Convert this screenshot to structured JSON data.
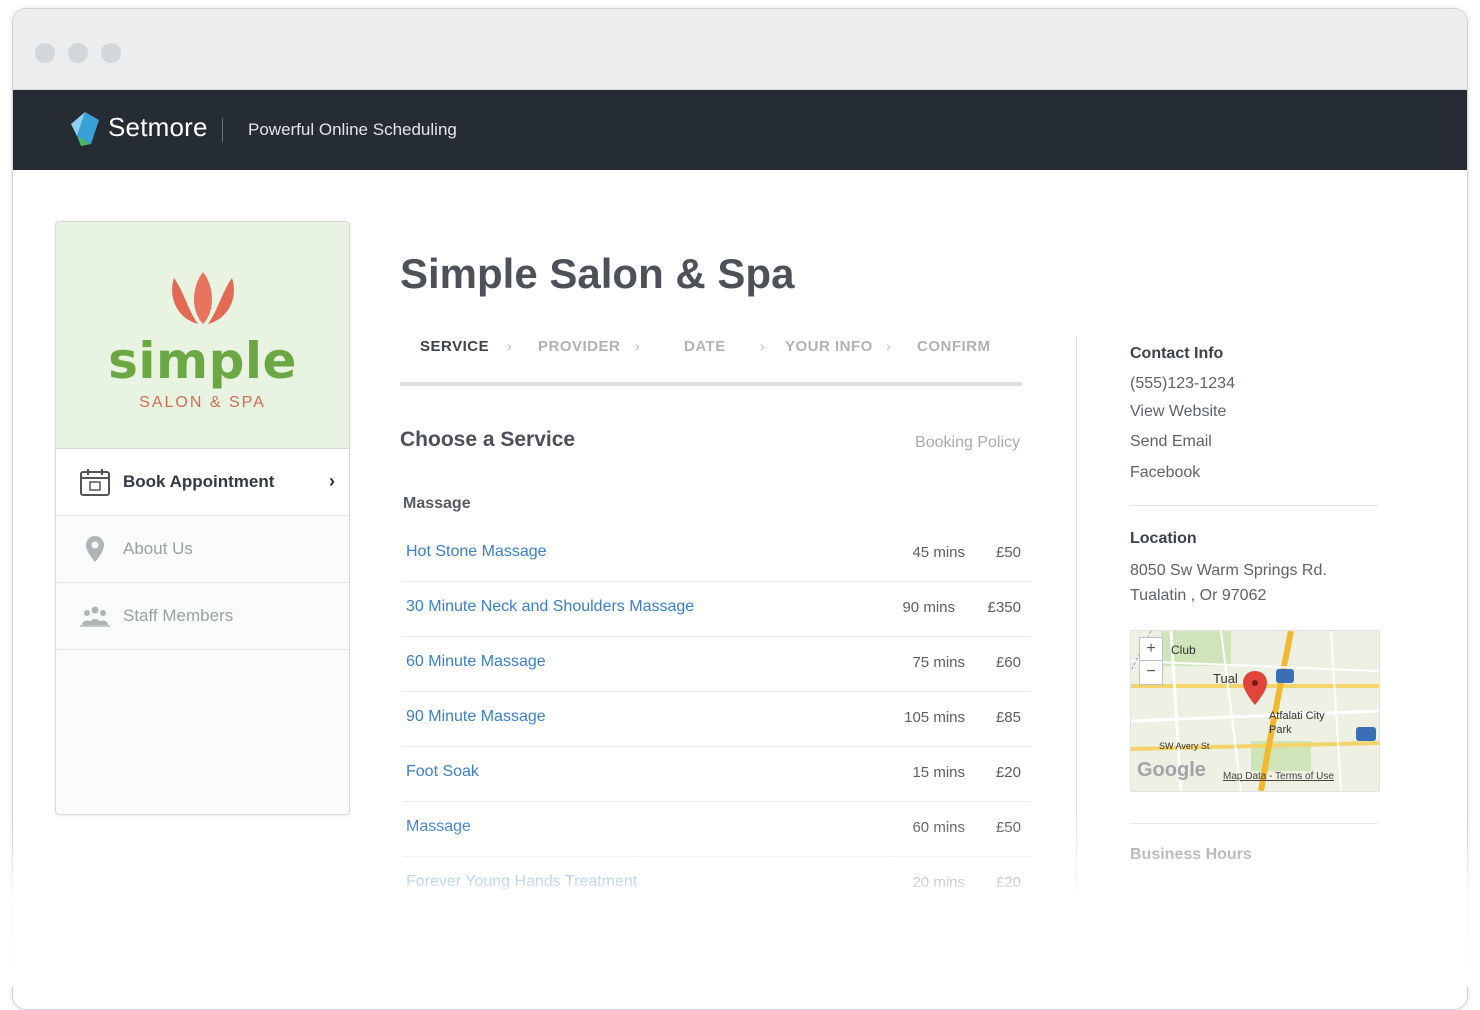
{
  "app": {
    "brand": "Setmore",
    "tagline": "Powerful Online Scheduling"
  },
  "business": {
    "logo_word": "simple",
    "logo_sub": "SALON & SPA",
    "name": "Simple Salon & Spa"
  },
  "sidebar": {
    "items": [
      {
        "label": "Book Appointment"
      },
      {
        "label": "About Us"
      },
      {
        "label": "Staff Members"
      }
    ]
  },
  "steps": [
    "SERVICE",
    "PROVIDER",
    "DATE",
    "YOUR INFO",
    "CONFIRM"
  ],
  "services": {
    "title": "Choose a Service",
    "policy_link": "Booking Policy",
    "category": "Massage",
    "rows": [
      {
        "name": "Hot Stone Massage",
        "duration": "45 mins",
        "price": "£50"
      },
      {
        "name": "30 Minute Neck and Shoulders Massage",
        "duration": "90 mins",
        "price": "£350"
      },
      {
        "name": "60 Minute Massage",
        "duration": "75 mins",
        "price": "£60"
      },
      {
        "name": "90 Minute Massage",
        "duration": "105 mins",
        "price": "£85"
      },
      {
        "name": "Foot Soak",
        "duration": "15 mins",
        "price": "£20"
      },
      {
        "name": "Massage",
        "duration": "60 mins",
        "price": "£50"
      },
      {
        "name": "Forever Young Hands Treatment",
        "duration": "20 mins",
        "price": "£20"
      }
    ]
  },
  "contact": {
    "title": "Contact Info",
    "phone": "(555)123-1234",
    "website": "View Website",
    "email": "Send Email",
    "facebook": "Facebook"
  },
  "location": {
    "title": "Location",
    "address1": "8050 Sw Warm Springs Rd.",
    "address2": "Tualatin , Or 97062",
    "map": {
      "label_club": "Club",
      "label_tual": "Tual",
      "label_park": "Atfalati City Park",
      "label_street": "SW Avery St",
      "label_google": "Google",
      "label_terms": "Map Data - Terms of Use",
      "zoom_in": "+",
      "zoom_out": "−"
    }
  },
  "hours": {
    "title": "Business Hours"
  },
  "colors": {
    "topbar": "#262c33",
    "link": "#3a7fc8",
    "logo_green": "#6ba843",
    "logo_coral": "#d46b56"
  }
}
